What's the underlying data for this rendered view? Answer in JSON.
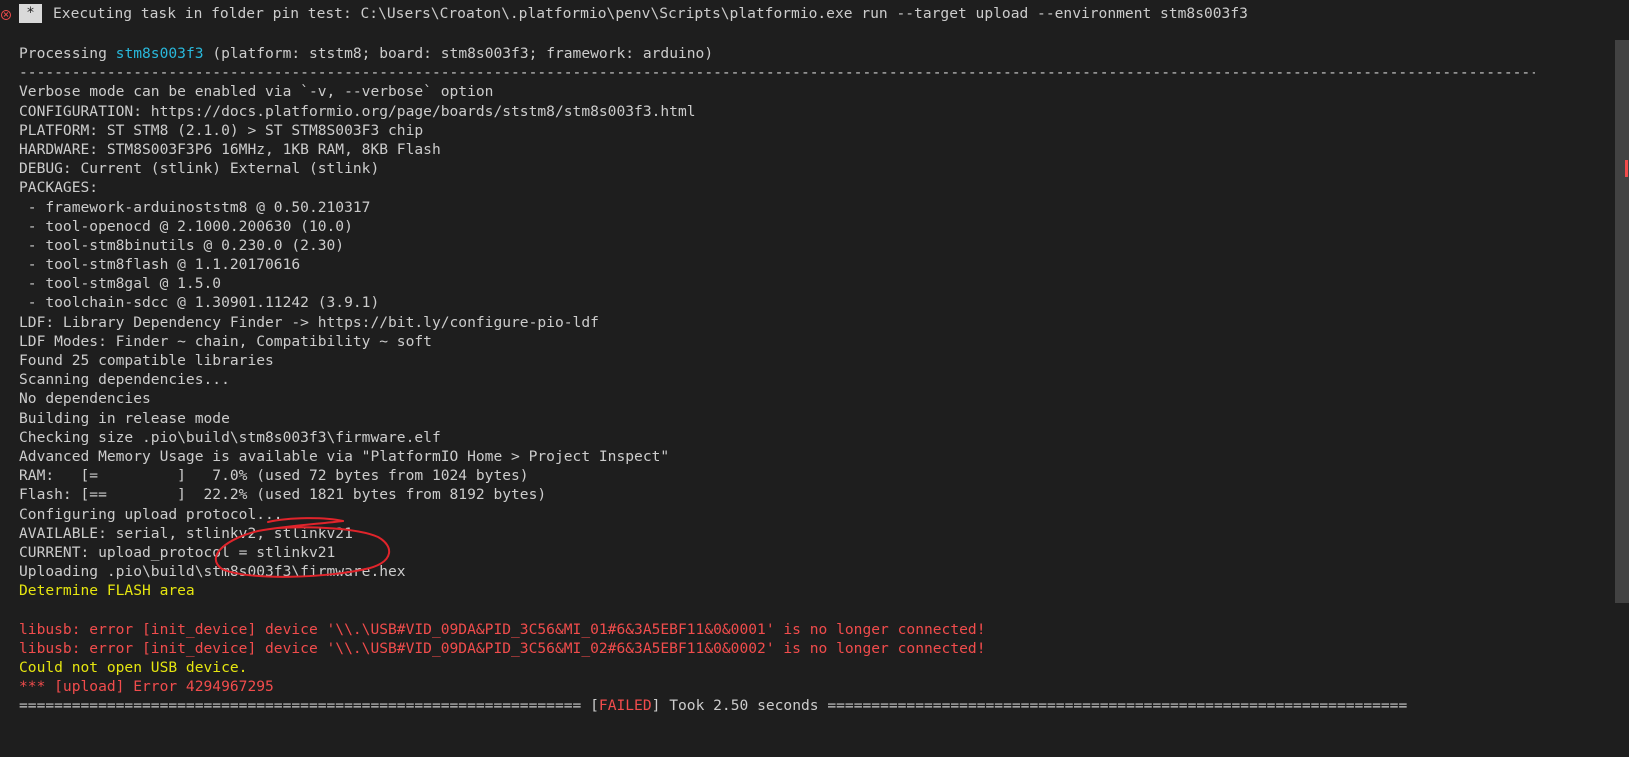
{
  "header": {
    "icon": "error-circle-icon",
    "badge": "*",
    "text": "Executing task in folder pin test: C:\\Users\\Croaton\\.platformio\\penv\\Scripts\\platformio.exe run --target upload --environment stm8s003f3"
  },
  "processing": {
    "prefix": "Processing ",
    "env": "stm8s003f3",
    "suffix": " (platform: ststm8; board: stm8s003f3; framework: arduino)"
  },
  "separator": "------------------------------------------------------------------------------------------------------------------------------------------------------------------------------------------------------------------------------------",
  "lines": [
    "Verbose mode can be enabled via `-v, --verbose` option",
    "CONFIGURATION: https://docs.platformio.org/page/boards/ststm8/stm8s003f3.html",
    "PLATFORM: ST STM8 (2.1.0) > ST STM8S003F3 chip",
    "HARDWARE: STM8S003F3P6 16MHz, 1KB RAM, 8KB Flash",
    "DEBUG: Current (stlink) External (stlink)",
    "PACKAGES:",
    " - framework-arduinoststm8 @ 0.50.210317",
    " - tool-openocd @ 2.1000.200630 (10.0)",
    " - tool-stm8binutils @ 0.230.0 (2.30)",
    " - tool-stm8flash @ 1.1.20170616",
    " - tool-stm8gal @ 1.5.0",
    " - toolchain-sdcc @ 1.30901.11242 (3.9.1)",
    "LDF: Library Dependency Finder -> https://bit.ly/configure-pio-ldf",
    "LDF Modes: Finder ~ chain, Compatibility ~ soft",
    "Found 25 compatible libraries",
    "Scanning dependencies...",
    "No dependencies",
    "Building in release mode",
    "Checking size .pio\\build\\stm8s003f3\\firmware.elf",
    "Advanced Memory Usage is available via \"PlatformIO Home > Project Inspect\"",
    "RAM:   [=         ]   7.0% (used 72 bytes from 1024 bytes)",
    "Flash: [==        ]  22.2% (used 1821 bytes from 8192 bytes)",
    "Configuring upload protocol...",
    "AVAILABLE: serial, stlinkv2, stlinkv21",
    "CURRENT: upload_protocol = stlinkv21",
    "Uploading .pio\\build\\stm8s003f3\\firmware.hex"
  ],
  "determine": "Determine FLASH area",
  "blank": "",
  "errors": [
    "libusb: error [init_device] device '\\\\.\\USB#VID_09DA&PID_3C56&MI_01#6&3A5EBF11&0&0001' is no longer connected!",
    "libusb: error [init_device] device '\\\\.\\USB#VID_09DA&PID_3C56&MI_02#6&3A5EBF11&0&0002' is no longer connected!"
  ],
  "could_not_open": "Could not open USB device.",
  "upload_error": "*** [upload] Error 4294967295",
  "summary": {
    "left_rule": "================================================================ ",
    "bracket_open": "[",
    "status": "FAILED",
    "bracket_close": "]",
    "took": " Took 2.50 seconds ",
    "right_rule": "=================================================================="
  },
  "colors": {
    "background": "#1e1e1e",
    "text": "#cccccc",
    "cyan": "#29b8db",
    "yellow": "#e5e510",
    "red": "#f14c4c",
    "annotation": "#e0242b"
  }
}
